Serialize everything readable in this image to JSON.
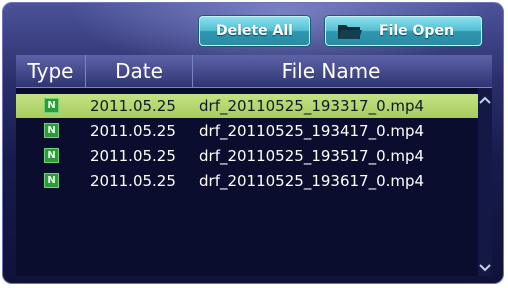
{
  "toolbar": {
    "delete_all_label": "Delete All",
    "file_open_label": "File Open"
  },
  "columns": {
    "type": "Type",
    "date": "Date",
    "file_name": "File Name"
  },
  "files": [
    {
      "type": "N",
      "date": "2011.05.25",
      "name": "drf_20110525_193317_0.mp4",
      "selected": true
    },
    {
      "type": "N",
      "date": "2011.05.25",
      "name": "drf_20110525_193417_0.mp4",
      "selected": false
    },
    {
      "type": "N",
      "date": "2011.05.25",
      "name": "drf_20110525_193517_0.mp4",
      "selected": false
    },
    {
      "type": "N",
      "date": "2011.05.25",
      "name": "drf_20110525_193617_0.mp4",
      "selected": false
    }
  ],
  "icons": {
    "folder": "folder-icon",
    "scroll_up": "chevron-up-icon",
    "scroll_down": "chevron-down-icon"
  },
  "colors": {
    "selected_row": "#b4d672",
    "badge": "#2f9a3c",
    "button": "#4fb8cf"
  }
}
